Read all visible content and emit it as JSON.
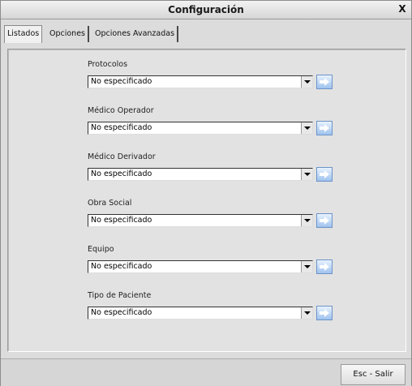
{
  "window": {
    "title": "Configuración",
    "close_label": "X"
  },
  "tabs": [
    {
      "label": "Listados",
      "active": true
    },
    {
      "label": "Opciones",
      "active": false
    },
    {
      "label": "Opciones Avanzadas",
      "active": false
    }
  ],
  "fields": [
    {
      "label": "Protocolos",
      "value": "No especificado"
    },
    {
      "label": "Médico Operador",
      "value": "No especificado"
    },
    {
      "label": "Médico Derivador",
      "value": "No especificado"
    },
    {
      "label": "Obra Social",
      "value": "No especificado"
    },
    {
      "label": "Equipo",
      "value": "No especificado"
    },
    {
      "label": "Tipo de Paciente",
      "value": "No especificado"
    }
  ],
  "footer": {
    "exit_label": "Esc - Salir"
  },
  "colors": {
    "go_button": "#9fc2ee",
    "panel": "#e2e2e2",
    "window": "#dcdcdc"
  },
  "icons": {
    "go_button": "arrow-right-icon",
    "select": "chevron-down-icon"
  }
}
